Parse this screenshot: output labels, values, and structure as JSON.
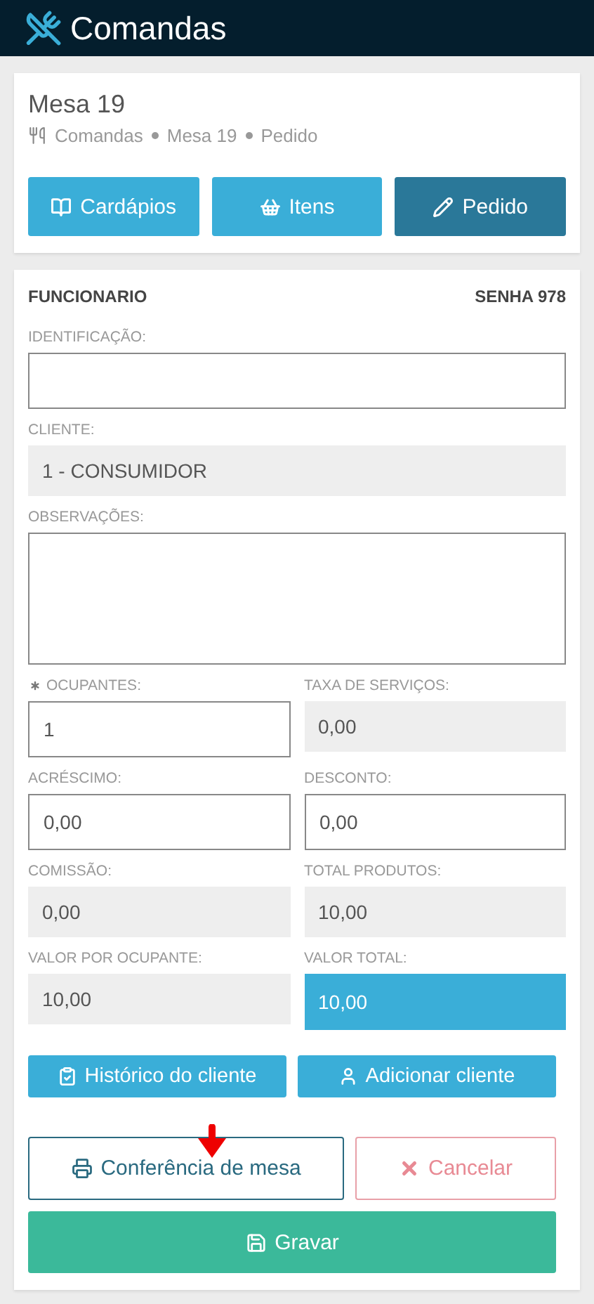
{
  "header": {
    "title": "Comandas"
  },
  "summary": {
    "title": "Mesa 19",
    "breadcrumb": [
      "Comandas",
      "Mesa 19",
      "Pedido"
    ]
  },
  "nav_buttons": [
    {
      "label": "Cardápios",
      "selected": false
    },
    {
      "label": "Itens",
      "selected": false
    },
    {
      "label": "Pedido",
      "selected": true
    }
  ],
  "form": {
    "employee": "FUNCIONARIO",
    "password": "SENHA 978",
    "full_fields": [
      {
        "label": "IDENTIFICAÇÃO:",
        "kind": "input"
      },
      {
        "label": "CLIENTE:",
        "kind": "readonly",
        "value": "1 - CONSUMIDOR"
      },
      {
        "label": "OBSERVAÇÕES:",
        "kind": "textarea"
      }
    ],
    "pair_fields": [
      {
        "label": "OCUPANTES:",
        "kind": "input",
        "value": "1",
        "required": true
      },
      {
        "label": "TAXA DE SERVIÇOS:",
        "kind": "readonly",
        "value": "0,00",
        "required": false
      },
      {
        "label": "ACRÉSCIMO:",
        "kind": "input",
        "value": "0,00",
        "required": false
      },
      {
        "label": "DESCONTO:",
        "kind": "input",
        "value": "0,00",
        "required": false
      },
      {
        "label": "COMISSÃO:",
        "kind": "readonly",
        "value": "0,00",
        "required": false
      },
      {
        "label": "TOTAL PRODUTOS:",
        "kind": "readonly",
        "value": "10,00",
        "required": false
      },
      {
        "label": "VALOR POR OCUPANTE:",
        "kind": "readonly",
        "value": "10,00",
        "required": false
      },
      {
        "label": "VALOR TOTAL:",
        "kind": "highlight",
        "value": "10,00",
        "required": false
      }
    ],
    "client_buttons": [
      {
        "label": "Histórico do cliente"
      },
      {
        "label": "Adicionar cliente"
      }
    ],
    "actions": [
      {
        "label": "Conferência de mesa",
        "kind": "outline-primary"
      },
      {
        "label": "Cancelar",
        "kind": "outline-danger"
      },
      {
        "label": "Gravar",
        "kind": "success"
      }
    ]
  }
}
